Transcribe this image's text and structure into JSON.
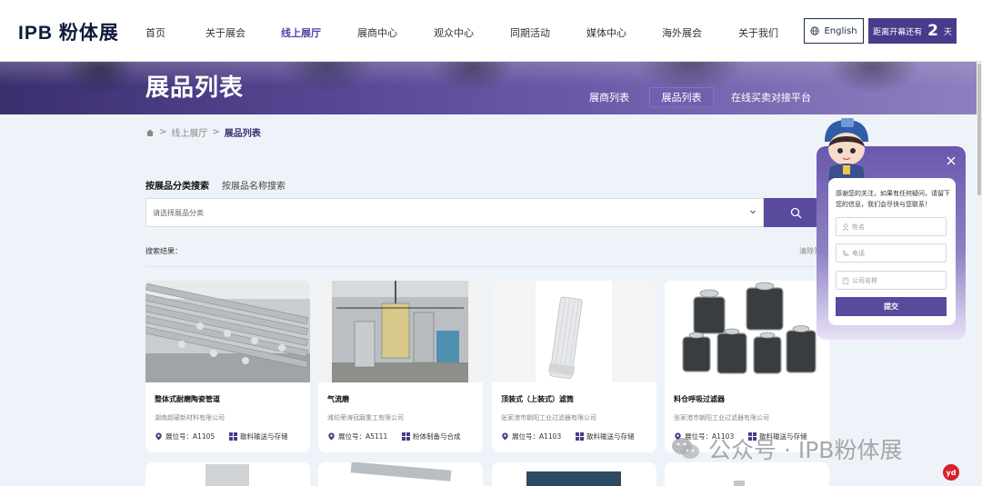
{
  "header": {
    "logo": "IPB 粉体展",
    "nav": [
      "首页",
      "关于展会",
      "线上展厅",
      "展商中心",
      "观众中心",
      "同期活动",
      "媒体中心",
      "海外展会",
      "关于我们"
    ],
    "active_nav": "线上展厅",
    "lang_label": "English",
    "countdown_prefix": "距离开幕还有",
    "countdown_num": "2",
    "countdown_unit": "天"
  },
  "banner": {
    "title": "展品列表",
    "subnav": [
      "展商列表",
      "展品列表",
      "在线买卖对接平台"
    ],
    "active_subnav": "展品列表"
  },
  "breadcrumb": {
    "items": [
      "线上展厅",
      "展品列表"
    ],
    "separator": ">"
  },
  "search": {
    "tabs": [
      "按展品分类搜索",
      "按展品名称搜索"
    ],
    "active_tab": "按展品分类搜索",
    "select_placeholder": "请选择展品分类",
    "results_label": "搜索结果：",
    "clear_label": "清除筛"
  },
  "products": [
    {
      "name": "整体式耐磨陶瓷管道",
      "company": "湖南超硬新材料有限公司",
      "booth": "展位号：A1105",
      "category": "散料输送与存储",
      "image": "ceramic-pipes"
    },
    {
      "name": "气流磨",
      "company": "潍坊荣涛冠磨重工有限公司",
      "booth": "展位号：A5111",
      "category": "粉体制备与合成",
      "image": "jet-mill"
    },
    {
      "name": "顶装式（上装式）滤筒",
      "company": "张家港市朝阳工业过滤器有限公司",
      "booth": "展位号：A1103",
      "category": "散料输送与存储",
      "image": "filter-cartridge"
    },
    {
      "name": "料仓呼吸过滤器",
      "company": "张家港市朝阳工业过滤器有限公司",
      "booth": "展位号：A1103",
      "category": "散料输送与存储",
      "image": "breather-filters"
    }
  ],
  "contact": {
    "message": "感谢您的关注，如果有任何疑问，请留下您的信息，我们会尽快与您联系！",
    "name_placeholder": "姓名",
    "phone_placeholder": "电话",
    "company_placeholder": "公司名称",
    "submit_label": "提交"
  },
  "watermark": {
    "text": "公众号 · IPB粉体展",
    "badge": "yd"
  },
  "colors": {
    "brand": "#4a3a8c",
    "accent": "#5a4a9e",
    "active_nav": "#5a3fa6"
  }
}
